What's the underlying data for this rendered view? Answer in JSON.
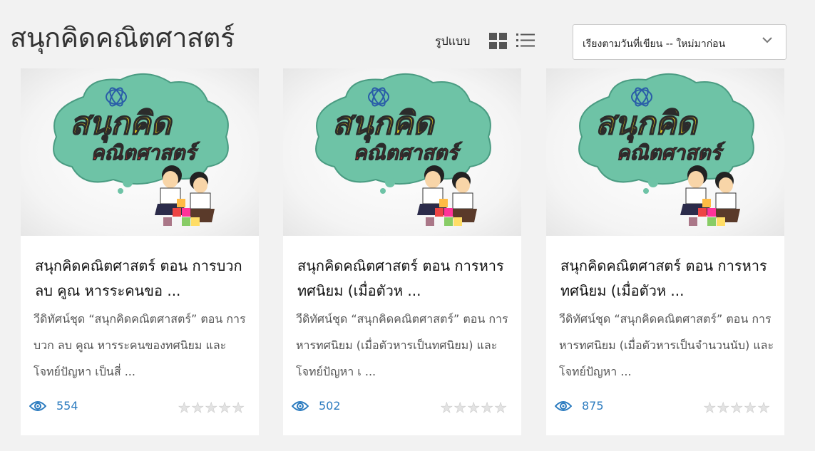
{
  "page": {
    "title": "สนุกคิดคณิตศาสตร์"
  },
  "toolbar": {
    "view_label": "รูปแบบ",
    "view_grid_icon": "grid-view-icon",
    "view_list_icon": "list-view-icon",
    "sort_value": "เรียงตามวันที่เขียน -- ใหม่มาก่อน"
  },
  "colors": {
    "accent": "#2b7bbf",
    "background": "#f2f2f2",
    "thumb_cloud": "#6ec3a6",
    "thumb_text_top": "#e8d020",
    "thumb_text_bottom": "#e22a2a"
  },
  "cards": [
    {
      "thumb_text_top": "สนุกคิด",
      "thumb_text_bottom": "คณิตศาสตร์",
      "title": "สนุกคิดคณิตศาสตร์ ตอน การบวก ลบ คูณ หารระคนขอ ...",
      "desc": "วีดิทัศน์ชุด “สนุกคิดคณิตศาสตร์” ตอน การบวก ลบ คูณ หารระคนของทศนิยม และโจทย์ปัญหา เป็นสี่ ...",
      "views": "554",
      "rating": 0
    },
    {
      "thumb_text_top": "สนุกคิด",
      "thumb_text_bottom": "คณิตศาสตร์",
      "title": "สนุกคิดคณิตศาสตร์ ตอน การหารทศนิยม (เมื่อตัวห ...",
      "desc": "วีดิทัศน์ชุด “สนุกคิดคณิตศาสตร์” ตอน การหารทศนิยม (เมื่อตัวหารเป็นทศนิยม) และโจทย์ปัญหา เ ...",
      "views": "502",
      "rating": 0
    },
    {
      "thumb_text_top": "สนุกคิด",
      "thumb_text_bottom": "คณิตศาสตร์",
      "title": "สนุกคิดคณิตศาสตร์ ตอน การหารทศนิยม (เมื่อตัวห ...",
      "desc": "วีดิทัศน์ชุด “สนุกคิดคณิตศาสตร์” ตอน การหารทศนิยม (เมื่อตัวหารเป็นจำนวนนับ) และโจทย์ปัญหา ...",
      "views": "875",
      "rating": 0
    }
  ]
}
